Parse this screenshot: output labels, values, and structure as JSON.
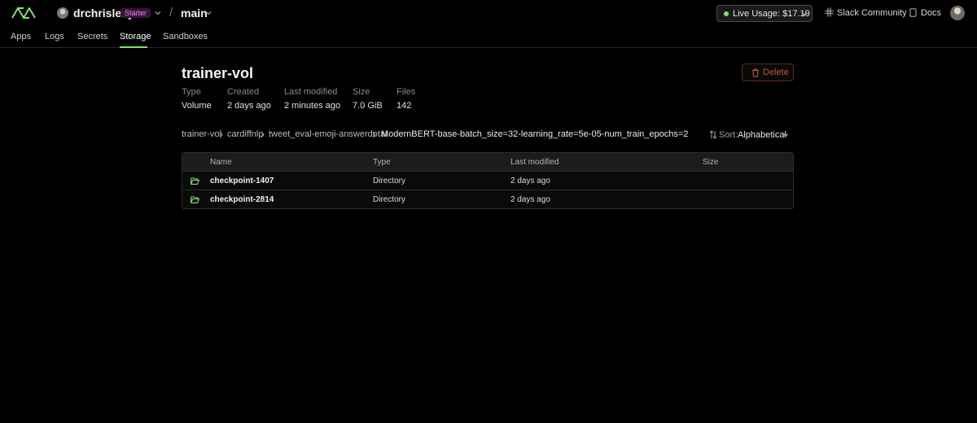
{
  "header": {
    "workspace": "drchrislevy",
    "plan_badge": "Starter",
    "separator": "/",
    "environment": "main",
    "live_usage": "Live Usage: $17.19",
    "slack": "Slack Community",
    "docs": "Docs",
    "accent_color": "#7fe36a"
  },
  "tabs": [
    {
      "label": "Apps"
    },
    {
      "label": "Logs"
    },
    {
      "label": "Secrets"
    },
    {
      "label": "Storage",
      "active": true
    },
    {
      "label": "Sandboxes"
    }
  ],
  "volume": {
    "title": "trainer-vol",
    "delete_label": "Delete",
    "meta": [
      {
        "key": "Type",
        "value": "Volume"
      },
      {
        "key": "Created",
        "value": "2 days ago"
      },
      {
        "key": "Last modified",
        "value": "2 minutes ago"
      },
      {
        "key": "Size",
        "value": "7.0 GiB"
      },
      {
        "key": "Files",
        "value": "142"
      }
    ]
  },
  "breadcrumb": [
    "trainer-vol",
    "cardiffnlp",
    "tweet_eval-emoji-answerdotai",
    "ModernBERT-base-batch_size=32-learning_rate=5e-05-num_train_epochs=2"
  ],
  "sort": {
    "label": "Sort:",
    "value": "Alphabetical"
  },
  "table": {
    "columns": [
      "Name",
      "Type",
      "Last modified",
      "Size"
    ],
    "rows": [
      {
        "name": "checkpoint-1407",
        "type": "Directory",
        "modified": "2 days ago",
        "size": "",
        "icon": "folder-open-icon"
      },
      {
        "name": "checkpoint-2814",
        "type": "Directory",
        "modified": "2 days ago",
        "size": "",
        "icon": "folder-open-icon"
      }
    ]
  }
}
